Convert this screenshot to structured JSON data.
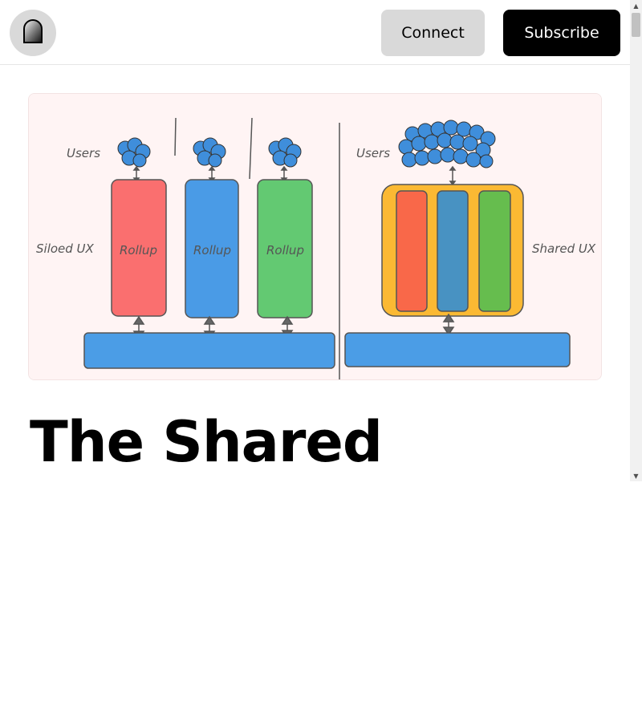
{
  "header": {
    "logo_icon": "arch-logo-icon",
    "connect_label": "Connect",
    "subscribe_label": "Subscribe"
  },
  "hero": {
    "users_left": "Users",
    "users_right": "Users",
    "siloed_label": "Siloed UX",
    "shared_label": "Shared UX",
    "rollup_labels": [
      "Rollup",
      "Rollup",
      "Rollup"
    ],
    "colors": {
      "background": "#fff4f4",
      "rollup_red": "#fa6f6f",
      "rollup_blue": "#4a9be6",
      "rollup_green": "#63c972",
      "shared_container": "#fbb933",
      "shared_red": "#f96849",
      "shared_blue": "#4892c2",
      "shared_green": "#66bd4e",
      "base_layer": "#4b9de6"
    }
  },
  "article": {
    "title": "The Shared"
  },
  "scrollbar": {
    "up_icon": "scroll-up-arrow-icon",
    "down_icon": "scroll-down-arrow-icon"
  }
}
